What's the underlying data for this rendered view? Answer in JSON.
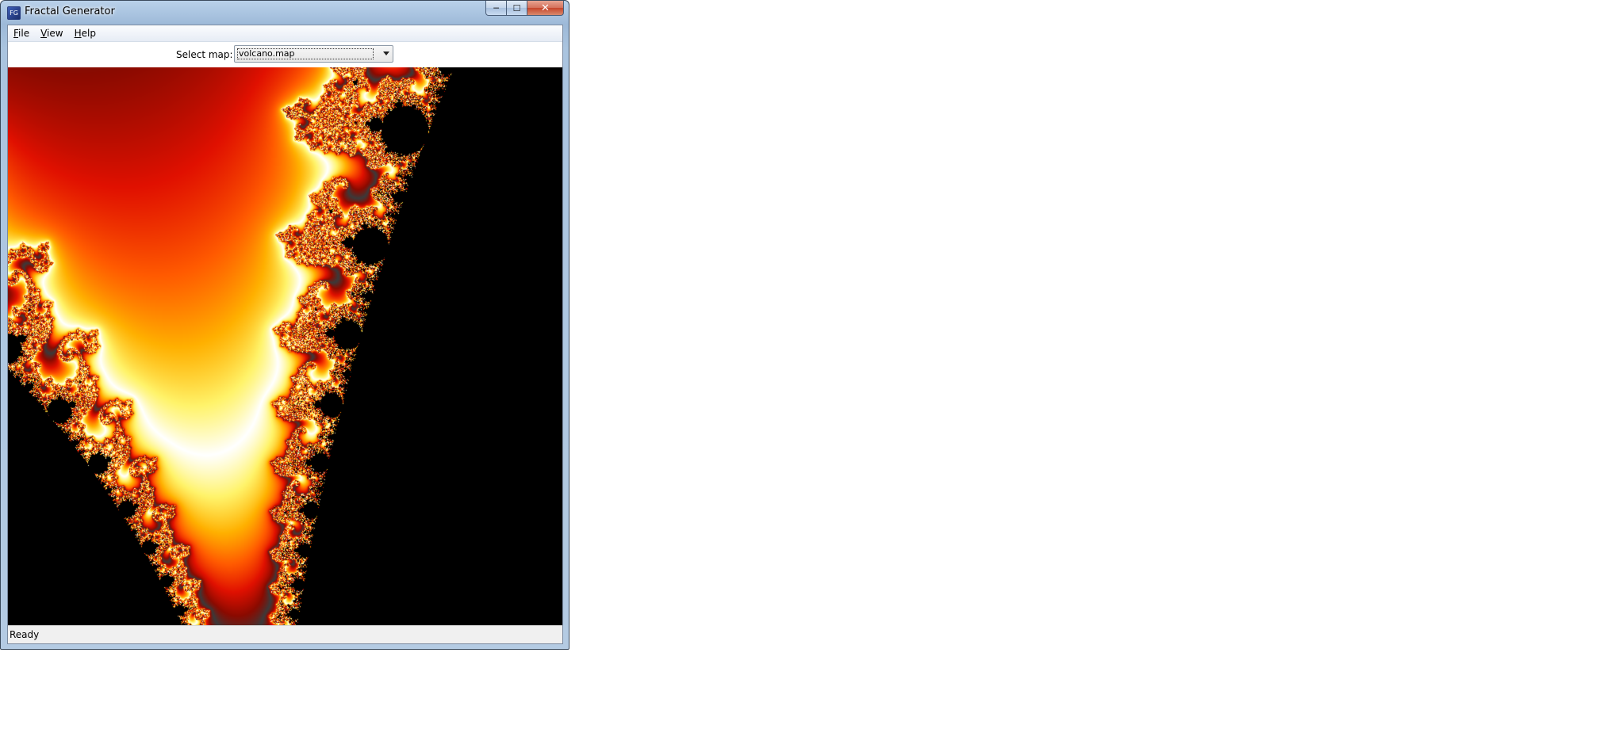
{
  "window": {
    "title": "Fractal Generator",
    "buttons": {
      "minimize": "─",
      "maximize": "☐",
      "close": "✕"
    }
  },
  "menu": [
    {
      "label": "File",
      "mnemonic": "F"
    },
    {
      "label": "View",
      "mnemonic": "V"
    },
    {
      "label": "Help",
      "mnemonic": "H"
    }
  ],
  "map_selector": {
    "label": "Select map:",
    "value": "volcano.map"
  },
  "status": {
    "text": "Ready"
  },
  "palette": [
    "#ffffff",
    "#fff36a",
    "#ffb000",
    "#ff5a00",
    "#e01000",
    "#8a0a00",
    "#3a3a3a",
    "#1a1a1a"
  ],
  "icons": {
    "app": "fractal-app-icon",
    "dropdown": "chevron-down-icon"
  }
}
